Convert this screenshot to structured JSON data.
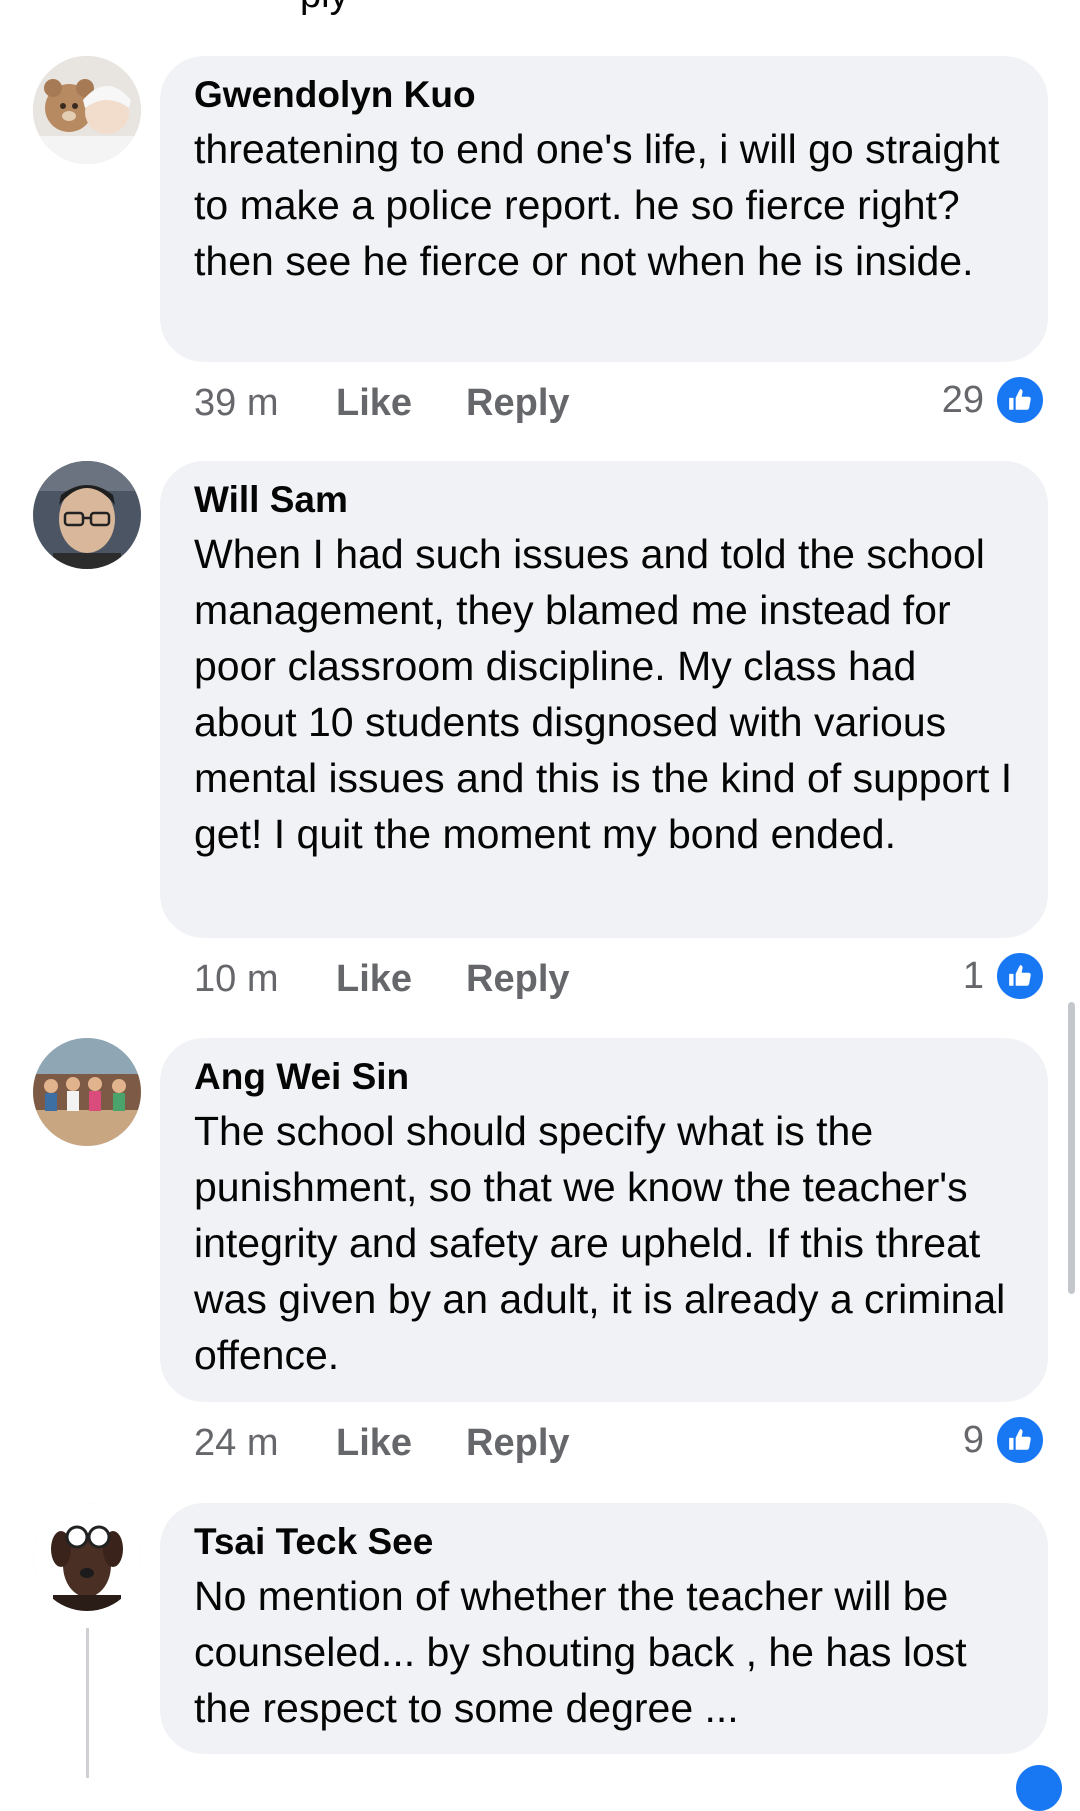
{
  "clipped_text": "ply",
  "actions": {
    "like_label": "Like",
    "reply_label": "Reply"
  },
  "comments": [
    {
      "author": "Gwendolyn Kuo",
      "text": "threatening to end one's life, i will go straight to make a police report. he so fierce right? then see he fierce or not when he is inside.",
      "time": "39 m",
      "likes": "29"
    },
    {
      "author": "Will Sam",
      "text": "When I had such issues and told the school management, they blamed me instead for poor classroom discipline. My class had about 10 students disgnosed with various mental issues and this is the kind of support I get! I quit the moment my bond ended.",
      "time": "10 m",
      "likes": "1"
    },
    {
      "author": "Ang Wei Sin",
      "text": "The school should specify what is the punishment, so that we know the teacher's integrity and safety are upheld. If this threat was given by an adult, it is already a criminal offence.",
      "time": "24 m",
      "likes": "9"
    },
    {
      "author": "Tsai Teck See",
      "text": "No mention of whether the teacher will be counseled... by shouting back , he has lost the respect to some degree ..."
    }
  ],
  "colors": {
    "bubble": "#f0f2f5",
    "meta_text": "#65676b",
    "like_blue": "#1877f2"
  },
  "icons": {
    "reaction": "thumbs-up-icon"
  }
}
